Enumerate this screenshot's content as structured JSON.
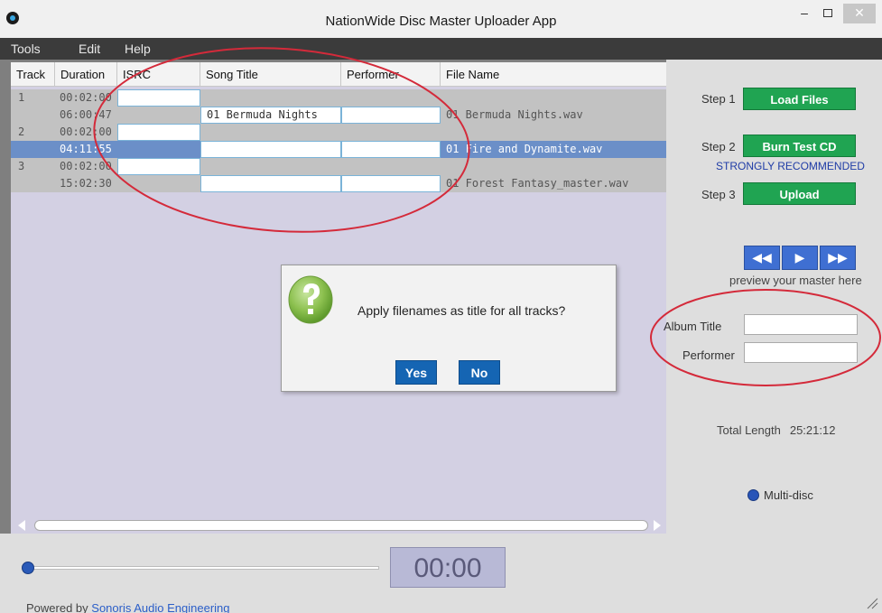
{
  "window": {
    "title": "NationWide Disc Master Uploader App",
    "minimize_glyph": "–",
    "close_glyph": "✕"
  },
  "menu": [
    "Tools",
    "Edit",
    "Help"
  ],
  "grid": {
    "columns": [
      "Track",
      "Duration",
      "ISRC",
      "Song Title",
      "Performer",
      "File Name"
    ],
    "rows": [
      {
        "track": "1",
        "duration": "00:02:00",
        "title": "",
        "file": "",
        "type": "gap"
      },
      {
        "track": "",
        "duration": "06:00:47",
        "title": "01 Bermuda Nights",
        "file": "01 Bermuda Nights.wav",
        "type": "song"
      },
      {
        "track": "2",
        "duration": "00:02:00",
        "title": "",
        "file": "",
        "type": "gap"
      },
      {
        "track": "",
        "duration": "04:11:55",
        "title": "",
        "file": "01 Fire and Dynamite.wav",
        "type": "song",
        "selected": true
      },
      {
        "track": "3",
        "duration": "00:02:00",
        "title": "",
        "file": "",
        "type": "gap"
      },
      {
        "track": "",
        "duration": "15:02:30",
        "title": "",
        "file": "01 Forest Fantasy_master.wav",
        "type": "song"
      }
    ]
  },
  "dialog": {
    "message": "Apply filenames as title for all tracks?",
    "yes_label": "Yes",
    "no_label": "No",
    "icon": "question-icon"
  },
  "steps": {
    "step1_label": "Step 1",
    "step1_button": "Load Files",
    "step2_label": "Step 2",
    "step2_button": "Burn Test CD",
    "recommendation": "STRONGLY RECOMMENDED",
    "step3_label": "Step 3",
    "step3_button": "Upload"
  },
  "transport": {
    "rewind": "◀◀",
    "play": "▶",
    "forward": "▶▶",
    "preview_text": "preview your master here"
  },
  "album": {
    "title_label": "Album Title",
    "title_value": "",
    "performer_label": "Performer",
    "performer_value": ""
  },
  "total": {
    "label": "Total Length",
    "value": "25:21:12"
  },
  "multidisc_label": "Multi-disc",
  "player": {
    "time": "00:00",
    "position": 0
  },
  "footer": {
    "powered_by": "Powered by",
    "link": "Sonoris Audio Engineering"
  },
  "colors": {
    "accent_green": "#20a452",
    "accent_blue": "#1565b3",
    "selection": "#6b8fc8",
    "annotation_red": "#d42a3a"
  }
}
